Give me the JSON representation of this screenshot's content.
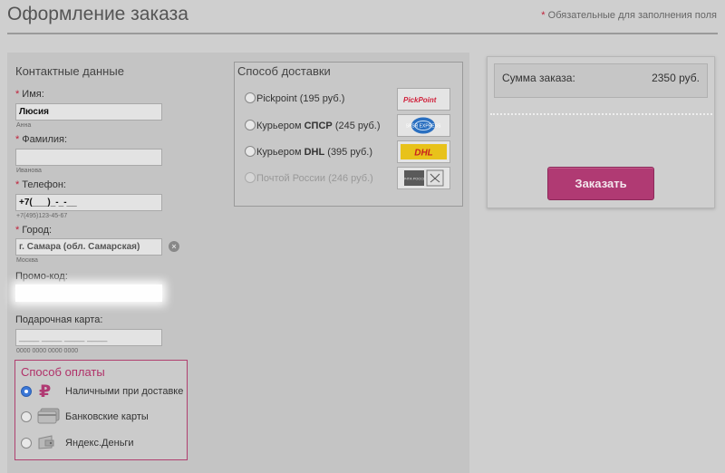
{
  "header": {
    "title": "Оформление заказа",
    "required_star": "*",
    "required_note": "Обязательные для заполнения поля"
  },
  "contact": {
    "title": "Контактные данные",
    "name": {
      "star": "*",
      "label": "Имя:",
      "value": "Люсия",
      "hint": "Анна"
    },
    "surname": {
      "star": "*",
      "label": "Фамилия:",
      "value": "",
      "hint": "Иванова"
    },
    "phone": {
      "star": "*",
      "label": "Телефон:",
      "value": "+7(___)_-_-__",
      "hint": "+7(495)123-45-67"
    },
    "city": {
      "star": "*",
      "label": "Город:",
      "value": "г. Самара (обл. Самарская)",
      "hint": "Москва"
    },
    "promo": {
      "label": "Промо-код:",
      "value": ""
    },
    "gift_card": {
      "label": "Подарочная карта:",
      "placeholder": "____ ____ ____ ____",
      "hint": "0000 0000 0000 0000"
    }
  },
  "payment": {
    "title": "Способ оплаты",
    "options": [
      {
        "label": "Наличными при доставке",
        "icon": "ruble-icon",
        "checked": true
      },
      {
        "label": "Банковские карты",
        "icon": "bank-card-icon",
        "checked": false
      },
      {
        "label": "Яндекс.Деньги",
        "icon": "yandex-money-icon",
        "checked": false
      }
    ]
  },
  "delivery": {
    "title": "Способ доставки",
    "options": [
      {
        "prefix": "Pickpoint",
        "name": "",
        "price": "(195 руб.)",
        "logo_text": "PickPoint",
        "logo": "pickpoint-logo",
        "disabled": false
      },
      {
        "prefix": "Курьером ",
        "name": "СПСР",
        "price": "(245 руб.)",
        "logo_text": "SPSR EXPRESS",
        "logo": "spsr-logo",
        "disabled": false
      },
      {
        "prefix": "Курьером ",
        "name": "DHL",
        "price": "(395 руб.)",
        "logo_text": "DHL",
        "logo": "dhl-logo",
        "disabled": false
      },
      {
        "prefix": "Почтой России",
        "name": "",
        "price": "(246 руб.)",
        "logo_text": "ПОЧТА РОССИИ",
        "logo": "russian-post-logo",
        "disabled": true
      }
    ]
  },
  "summary": {
    "label": "Сумма заказа:",
    "value": "2350 руб.",
    "order_button": "Заказать"
  },
  "colors": {
    "accent": "#b03a73",
    "required": "#c0203a",
    "radio_checked": "#3b78d8"
  }
}
